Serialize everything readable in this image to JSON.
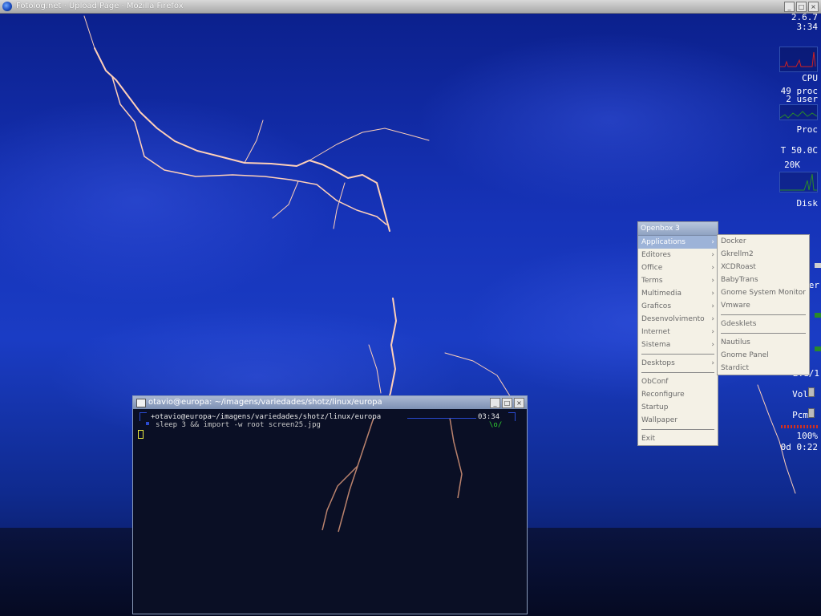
{
  "window": {
    "title": "Fotolog.net · Upload Page · Mozilla Firefox",
    "buttons": [
      "_",
      "□",
      "×"
    ]
  },
  "gkrellm": {
    "kernel": "2.6.7",
    "time": "3:34",
    "cpu_label": "CPU",
    "procs": "49 proc",
    "users": "2 user",
    "proc_label": "Proc",
    "temp": "T 50.0C",
    "disk_rate": "20K",
    "disk_label": "Disk",
    "net_frag": "ner",
    "ratio_frag": "2.1/1",
    "vol_label": "Vol",
    "pcm_label": "Pcm",
    "battery": "100%",
    "uptime": "0d 0:22",
    "colors": {
      "graph": "#2a8a2a",
      "alert": "#d02020"
    }
  },
  "menu_main": {
    "header": "Openbox 3",
    "items": [
      {
        "label": "Applications",
        "sub": true,
        "active": true
      },
      {
        "label": "Editores",
        "sub": true
      },
      {
        "label": "Office",
        "sub": true
      },
      {
        "label": "Terms",
        "sub": true
      },
      {
        "label": "Multimedia",
        "sub": true
      },
      {
        "label": "Graficos",
        "sub": true
      },
      {
        "label": "Desenvolvimento",
        "sub": true
      },
      {
        "label": "Internet",
        "sub": true
      },
      {
        "label": "Sistema",
        "sub": true
      },
      {
        "sep": true
      },
      {
        "label": "Desktops",
        "sub": true
      },
      {
        "sep": true
      },
      {
        "label": "ObConf"
      },
      {
        "label": "Reconfigure"
      },
      {
        "label": "Startup"
      },
      {
        "label": "Wallpaper"
      },
      {
        "sep": true
      },
      {
        "label": "Exit"
      }
    ]
  },
  "menu_apps": {
    "items": [
      {
        "label": "Docker"
      },
      {
        "label": "Gkrellm2"
      },
      {
        "label": "XCDRoast"
      },
      {
        "label": "BabyTrans"
      },
      {
        "label": "Gnome System Monitor"
      },
      {
        "label": "Vmware"
      },
      {
        "sep": true
      },
      {
        "label": "Gdesklets"
      },
      {
        "sep": true
      },
      {
        "label": "Nautilus"
      },
      {
        "label": "Gnome Panel"
      },
      {
        "label": "Stardict"
      }
    ]
  },
  "terminal": {
    "title": "otavio@europa: ~/imagens/variedades/shotz/linux/europa",
    "prompt_line": "+otavio@europa~/imagens/variedades/shotz/linux/europa",
    "clock": "03:34",
    "command": "sleep 3 && import -w root screen25.jpg",
    "face": "\\o/"
  }
}
